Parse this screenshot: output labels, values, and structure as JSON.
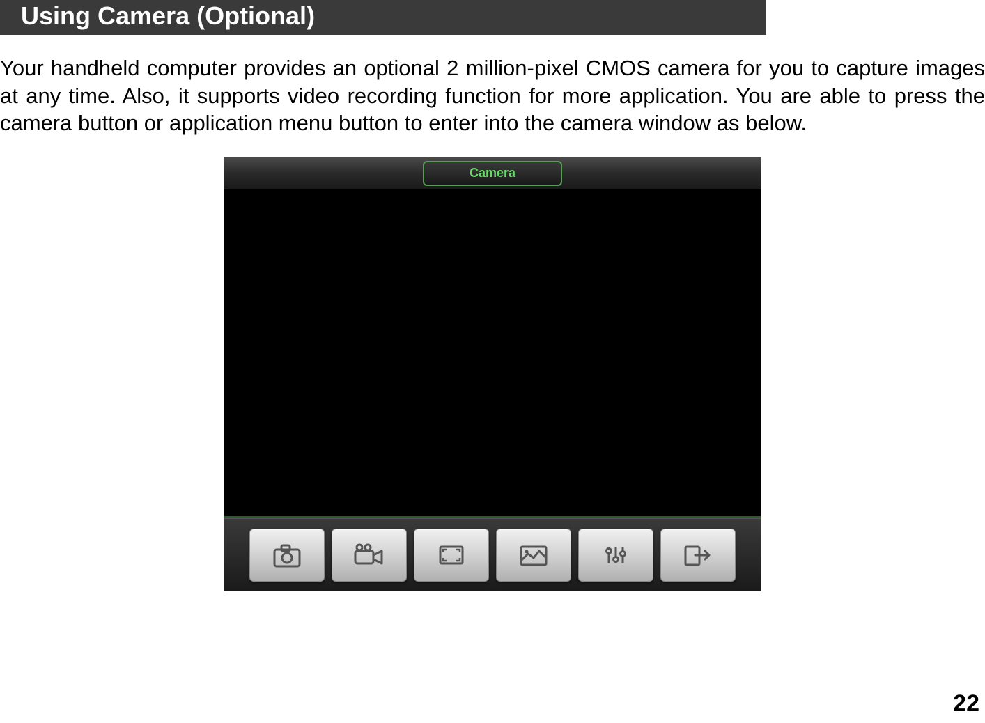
{
  "header": {
    "title": "Using Camera (Optional)"
  },
  "body": {
    "paragraph": "Your handheld computer provides an optional 2 million-pixel CMOS camera for you to capture images at any time. Also, it supports video recording function for more application. You are able to press the camera button or application menu button to enter into the camera window as below."
  },
  "camera": {
    "title": "Camera",
    "toolbar": {
      "icons": [
        "capture-icon",
        "video-icon",
        "fullscreen-icon",
        "gallery-icon",
        "settings-icon",
        "exit-icon"
      ]
    }
  },
  "page_number": "22"
}
